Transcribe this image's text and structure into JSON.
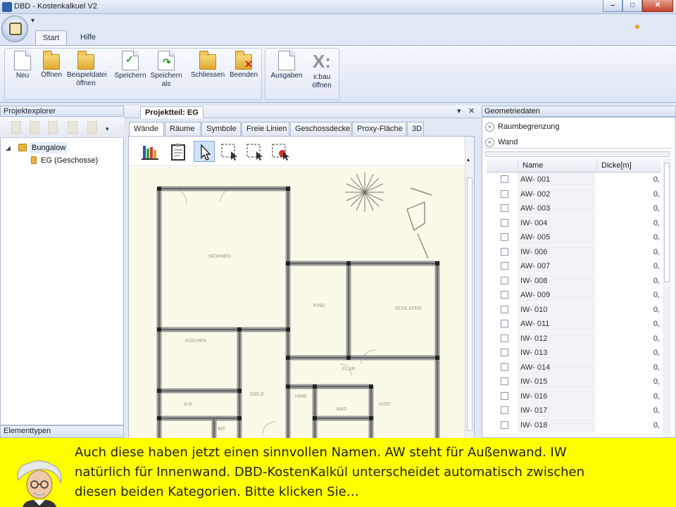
{
  "window": {
    "title": "DBD - Kostenkalkuel V2",
    "min": "‒",
    "max": "□",
    "close": "✕"
  },
  "quick_access": "▾",
  "ribbon_tabs": [
    {
      "label": "Start"
    },
    {
      "label": "Hilfe"
    }
  ],
  "ribbon_buttons": [
    {
      "label": "Neu"
    },
    {
      "label": "Öffnen"
    },
    {
      "label": "Beispieldatei öffnen"
    },
    {
      "label": "Speichern"
    },
    {
      "label": "Speichern als"
    },
    {
      "label": "Schliessen"
    },
    {
      "label": "Beenden"
    },
    {
      "label": "Ausgaben"
    },
    {
      "label": "x:bau öffnen"
    }
  ],
  "project_explorer": {
    "title": "Projektexplorer",
    "tree": [
      {
        "label": "Bungalow"
      },
      {
        "label": "EG (Geschosse)"
      }
    ]
  },
  "element_types": {
    "title": "Elementtypen"
  },
  "document": {
    "title": "Projektteil: EG",
    "dropdown": "▾",
    "close": "✕",
    "tabs": [
      {
        "label": "Wände"
      },
      {
        "label": "Räume"
      },
      {
        "label": "Symbole"
      },
      {
        "label": "Freie Linien"
      },
      {
        "label": "Geschossdecke"
      },
      {
        "label": "Proxy-Fläche"
      },
      {
        "label": "3D"
      }
    ],
    "rooms": [
      "WOHNEN",
      "KIND",
      "SCHLAFEN",
      "KOCHEN",
      "FLUR",
      "A.R.",
      "DIELE",
      "HWR",
      "BAD",
      "WC",
      "KIND"
    ]
  },
  "geometry": {
    "title": "Geometriedaten",
    "sections": [
      {
        "label": "Raumbegrenzung",
        "icon": "˅"
      },
      {
        "label": "Wand",
        "icon": "˄"
      }
    ],
    "columns": [
      {
        "label": "Name"
      },
      {
        "label": "Dicke[m]"
      }
    ],
    "rows": [
      {
        "name": "AW- 001",
        "value": "0,"
      },
      {
        "name": "AW- 002",
        "value": "0,"
      },
      {
        "name": "AW- 003",
        "value": "0,"
      },
      {
        "name": "IW- 004",
        "value": "0,"
      },
      {
        "name": "AW- 005",
        "value": "0,"
      },
      {
        "name": "IW- 006",
        "value": "0,"
      },
      {
        "name": "AW- 007",
        "value": "0,"
      },
      {
        "name": "IW- 008",
        "value": "0,"
      },
      {
        "name": "AW- 009",
        "value": "0,"
      },
      {
        "name": "IW- 010",
        "value": "0,"
      },
      {
        "name": "AW- 011",
        "value": "0,"
      },
      {
        "name": "IW- 012",
        "value": "0,"
      },
      {
        "name": "IW- 013",
        "value": "0,"
      },
      {
        "name": "AW- 014",
        "value": "0,"
      },
      {
        "name": "IW- 015",
        "value": "0,"
      },
      {
        "name": "IW- 016",
        "value": "0,"
      },
      {
        "name": "IW- 017",
        "value": "0,"
      },
      {
        "name": "IW- 018",
        "value": "0,"
      }
    ]
  },
  "tutorial": {
    "lines": [
      "Auch diese haben jetzt einen sinnvollen Namen. AW steht für Außenwand. IW",
      "natürlich für Innenwand. DBD-KostenKalkül unterscheidet automatisch zwischen",
      "diesen beiden Kategorien. Bitte klicken Sie…"
    ]
  },
  "colors": {
    "banner": "#ffff00",
    "wall": "#555555",
    "canvas": "#fbf9e8"
  }
}
